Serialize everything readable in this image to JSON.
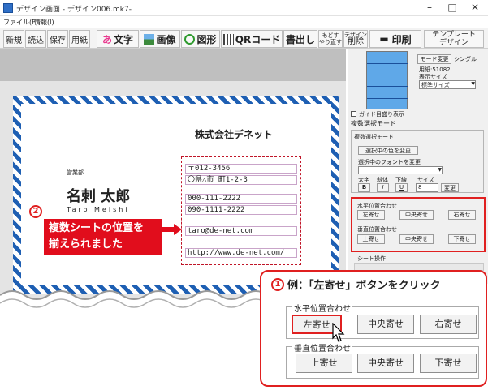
{
  "window": {
    "title": "デザイン画面 - デザイン006.mk7-",
    "minimize": "–",
    "maximize": "□",
    "close": "✕"
  },
  "menu": [
    "ファイル(F)",
    "情報(I)"
  ],
  "toolbar": {
    "new": "新規",
    "load": "読込",
    "save": "保存",
    "paper": "用紙",
    "text": "文字",
    "image": "画像",
    "shape": "図形",
    "qr": "QRコード",
    "print_write": "書出し",
    "undo1": "もどす",
    "undo2": "やり直す",
    "del1": "デザイン",
    "del2": "削除",
    "print": "印刷",
    "tmpl1": "テンプレート",
    "tmpl2": "デザイン"
  },
  "card": {
    "company": "株式会社デネット",
    "department": "営業部",
    "name": "名刺 太郎",
    "name_roman": "Taro  Meishi",
    "fields": [
      "〒012-3456",
      "〇県△市□町1-2-3",
      "000-111-2222",
      "090-1111-2222",
      "taro@de-net.com",
      "http://www.de-net.com/"
    ]
  },
  "step2": {
    "number": "2",
    "line1": "複数シートの位置を",
    "line2": "揃えられました"
  },
  "panel": {
    "mode_change": "モード変更",
    "single": "シングル",
    "paper_code": "用紙:51082",
    "display_size": "表示サイズ",
    "display_size_value": "標準サイズ",
    "guide": "ガイド目盛り表示",
    "multi_mode": "複数選択モード",
    "multi_mode_inner": "複数選択モード",
    "change_color": "選択中の色を変更",
    "change_font": "選択中のフォントを変更",
    "bold": "太字",
    "italic": "斜体",
    "underline": "下線",
    "size": "サイズ",
    "bold_btn": "B",
    "italic_btn": "I",
    "underline_btn": "U",
    "size_value": "8",
    "size_apply": "変更",
    "h_align": "水平位置合わせ",
    "v_align": "垂直位置合わせ",
    "left": "左寄せ",
    "center": "中央寄せ",
    "right": "右寄せ",
    "top": "上寄せ",
    "vcenter": "中央寄せ",
    "bottom": "下寄せ",
    "sheet_ops": "シート操作"
  },
  "step1": {
    "number": "1",
    "text": "例：「左寄せ」ボタンをクリック"
  },
  "callout": {
    "h_align": "水平位置合わせ",
    "v_align": "垂直位置合わせ",
    "left": "左寄せ",
    "center": "中央寄せ",
    "right": "右寄せ",
    "top": "上寄せ",
    "vcenter": "中央寄せ",
    "bottom": "下寄せ"
  },
  "colors": {
    "accent_red": "#e02020",
    "card_blue": "#1e5fb3",
    "msg_red": "#e10d1c"
  }
}
